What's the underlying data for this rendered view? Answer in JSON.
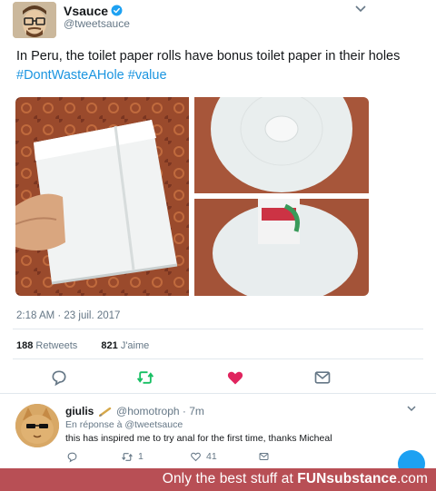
{
  "tweet": {
    "author_name": "Vsauce",
    "author_handle": "@tweetsauce",
    "text_before": "In Peru, the toilet paper rolls have bonus toilet paper in their holes ",
    "hashtags": [
      "#DontWasteAHole",
      "#value"
    ],
    "timestamp": "2:18 AM · 23 juil. 2017",
    "retweets_count": "188",
    "retweets_label": "Retweets",
    "likes_count": "821",
    "likes_label": "J'aime",
    "liked": true
  },
  "reply": {
    "author_name": "giulis",
    "author_handle": "@homotroph · 7m",
    "reply_to_prefix": "En réponse à ",
    "reply_to_handle": "@tweetsauce",
    "text": "this has inspired me to try anal for the first time, thanks Micheal",
    "retweet_count": "1",
    "like_count": "41"
  },
  "footer": {
    "prefix": "Only the best stuff at ",
    "brand_a": "FUN",
    "brand_b": "substance",
    "suffix": ".com"
  },
  "colors": {
    "accent": "#1da1f2",
    "hashtag": "#1b95e0",
    "retweet_green": "#17bf63",
    "like_red": "#e0245e",
    "footer_bg": "#b84f55"
  },
  "icons": {
    "verified": "verified-badge-icon",
    "chevron": "chevron-down-icon",
    "reply": "reply-icon",
    "retweet": "retweet-icon",
    "like": "heart-icon",
    "message": "envelope-icon",
    "compose": "compose-icon"
  }
}
